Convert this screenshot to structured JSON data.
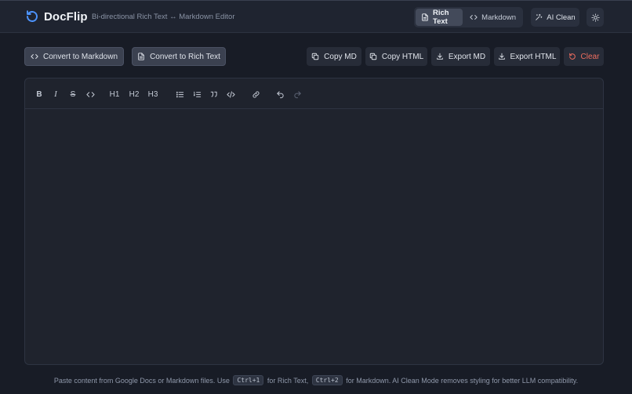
{
  "header": {
    "app_name": "DocFlip",
    "tagline": "Bi-directional Rich Text ↔ Markdown Editor",
    "modes": [
      {
        "label": "Rich Text",
        "icon": "document-icon",
        "active": true
      },
      {
        "label": "Markdown",
        "icon": "code-icon",
        "active": false
      }
    ],
    "ai_clean_label": "AI Clean",
    "theme_icon": "sun-icon"
  },
  "actions": {
    "convert_to_markdown": "Convert to Markdown",
    "convert_to_rich_text": "Convert to Rich Text",
    "copy_md": "Copy MD",
    "copy_html": "Copy HTML",
    "export_md": "Export MD",
    "export_html": "Export HTML",
    "clear": "Clear"
  },
  "toolbar": {
    "bold": "B",
    "italic": "I",
    "strike": "S",
    "h1": "H1",
    "h2": "H2",
    "h3": "H3",
    "tools": [
      "bold",
      "italic",
      "strikethrough",
      "inline-code",
      "heading-1",
      "heading-2",
      "heading-3",
      "bullet-list",
      "numbered-list",
      "blockquote",
      "code-block",
      "link",
      "undo",
      "redo"
    ]
  },
  "editor": {
    "content": ""
  },
  "footer": {
    "text_1": "Paste content from Google Docs or Markdown files. Use",
    "kbd_1": "Ctrl+1",
    "text_2": "for Rich Text,",
    "kbd_2": "Ctrl+2",
    "text_3": "for Markdown. AI Clean Mode removes styling for better LLM compatibility."
  },
  "colors": {
    "background": "#181c26",
    "header_bg": "#1f2430",
    "accent": "#4d94ff",
    "danger": "#ee6d5f",
    "panel": "#1f232d"
  }
}
